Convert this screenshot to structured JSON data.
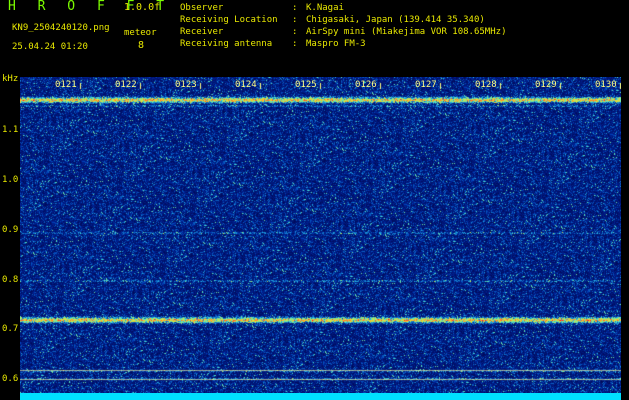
{
  "header": {
    "title": "H R O F F T",
    "version": "1.0.0f",
    "filename": "KN9_2504240120.png",
    "meteor_label": "meteor",
    "meteor_count": "8",
    "datetime": "25.04.24 01:20"
  },
  "info": [
    {
      "key": "Observer",
      "value": "K.Nagai"
    },
    {
      "key": "Receiving Location",
      "value": "Chigasaki, Japan (139.414 35.340)"
    },
    {
      "key": "Receiver",
      "value": "AirSpy mini (Miakejima VOR 108.65MHz)"
    },
    {
      "key": "Receiving antenna",
      "value": "Maspro FM-3"
    }
  ],
  "axis": {
    "y_unit": "kHz",
    "y_ticks": [
      "1.1",
      "1.0",
      "0.9",
      "0.8",
      "0.7",
      "0.6"
    ],
    "x_ticks": [
      "0121",
      "0122",
      "0123",
      "0124",
      "0125",
      "0126",
      "0127",
      "0128",
      "0129",
      "0130"
    ]
  },
  "colors": {
    "background": "#000000",
    "label_text": "#e8e800",
    "title_text": "#7CFC00",
    "spectrum_base": "#00208a",
    "baseline": "#00e0ff"
  },
  "spectrogram": {
    "y_range_khz": [
      0.58,
      1.14
    ],
    "bands_khz": [
      1.1,
      0.71
    ],
    "faint_lines_khz": [
      1.09,
      0.865,
      0.78,
      0.62,
      0.605
    ]
  }
}
